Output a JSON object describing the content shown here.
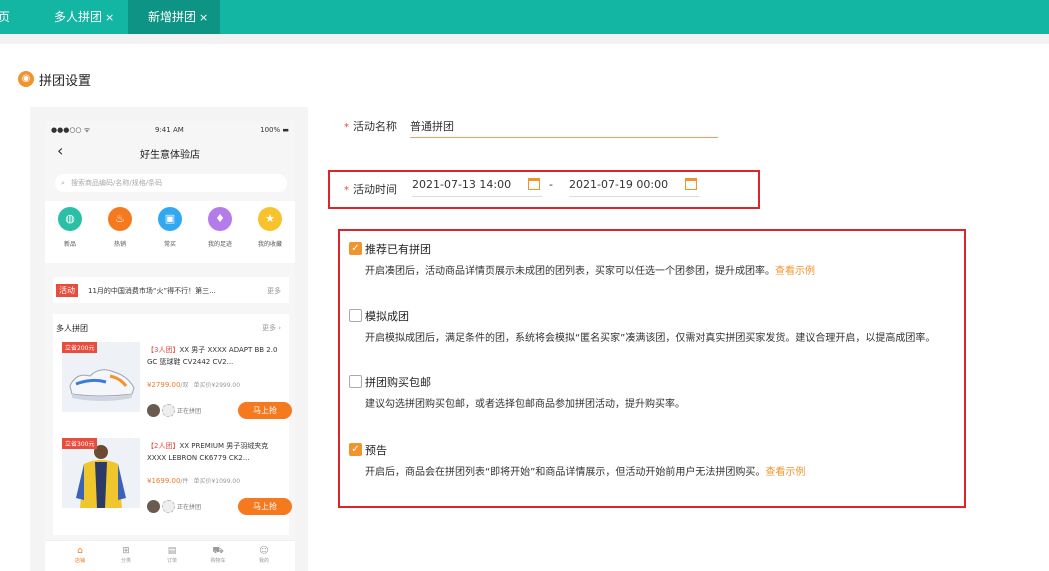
{
  "tabs": [
    {
      "label": "首页",
      "display": "页"
    },
    {
      "label": "多人拼团",
      "close": "×"
    },
    {
      "label": "新增拼团",
      "close": "×"
    }
  ],
  "page_title": "拼团设置",
  "preview": {
    "status_left": "●●●○○ ᯤ",
    "time": "9:41 AM",
    "battery": "100%",
    "store_name": "好生意体验店",
    "search_placeholder": "搜索商品编码/名称/规格/条码",
    "shortcuts": [
      {
        "label": "新品",
        "icon": "new-icon",
        "color": "#2bbfa6"
      },
      {
        "label": "热销",
        "icon": "hot-icon",
        "color": "#f5791f"
      },
      {
        "label": "常买",
        "icon": "bag-icon",
        "color": "#31a8f0"
      },
      {
        "label": "我的足迹",
        "icon": "footprint-icon",
        "color": "#b57bea"
      },
      {
        "label": "我的收藏",
        "icon": "star-icon",
        "color": "#f8c22c"
      }
    ],
    "notice": {
      "tag": "活动",
      "text": "11月的中国消费市场“火”得不行！第三...",
      "more": "更多"
    },
    "group": {
      "title": "多人拼团",
      "more": "更多 ›",
      "products": [
        {
          "save": "立省200元",
          "tag": "【3人团】",
          "name": "XX 男子 XXXX ADAPT BB 2.0 GC 篮球鞋 CV2442 CV2...",
          "price": "¥2799.00",
          "unit": "/双",
          "orig": "单买价¥2999.00",
          "status": "正在拼团",
          "button": "马上抢"
        },
        {
          "save": "立省300元",
          "tag": "【2人团】",
          "name": "XX PREMIUM 男子羽绒夹克 XXXX LEBRON CK6779 CK2...",
          "price": "¥1699.00",
          "unit": "/件",
          "orig": "单买价¥1099.00",
          "status": "正在拼团",
          "button": "马上抢"
        }
      ]
    },
    "tabbar": [
      {
        "label": "店铺",
        "icon": "home-icon"
      },
      {
        "label": "分类",
        "icon": "category-icon"
      },
      {
        "label": "订单",
        "icon": "order-icon"
      },
      {
        "label": "购物车",
        "icon": "cart-icon"
      },
      {
        "label": "我的",
        "icon": "user-icon"
      }
    ]
  },
  "form": {
    "name_label": "活动名称",
    "name_value": "普通拼团",
    "time_label": "活动时间",
    "start": "2021-07-13 14:00",
    "end": "2021-07-19 00:00",
    "separator": "-",
    "options": [
      {
        "title": "推荐已有拼团",
        "checked": true,
        "desc": "开启凑团后，活动商品详情页展示未成团的团列表，买家可以任选一个团参团，提升成团率。",
        "link": "查看示例"
      },
      {
        "title": "模拟成团",
        "checked": false,
        "desc": "开启模拟成团后，满足条件的团，系统将会模拟“匿名买家”凑满该团，仅需对真实拼团买家发货。建议合理开启，以提高成团率。",
        "link": ""
      },
      {
        "title": "拼团购买包邮",
        "checked": false,
        "desc": "建议勾选拼团购买包邮，或者选择包邮商品参加拼团活动，提升购买率。",
        "link": ""
      },
      {
        "title": "预告",
        "checked": true,
        "desc": "开启后，商品会在拼团列表“即将开始”和商品详情展示，但活动开始前用户无法拼团购买。",
        "link": "查看示例"
      }
    ]
  }
}
